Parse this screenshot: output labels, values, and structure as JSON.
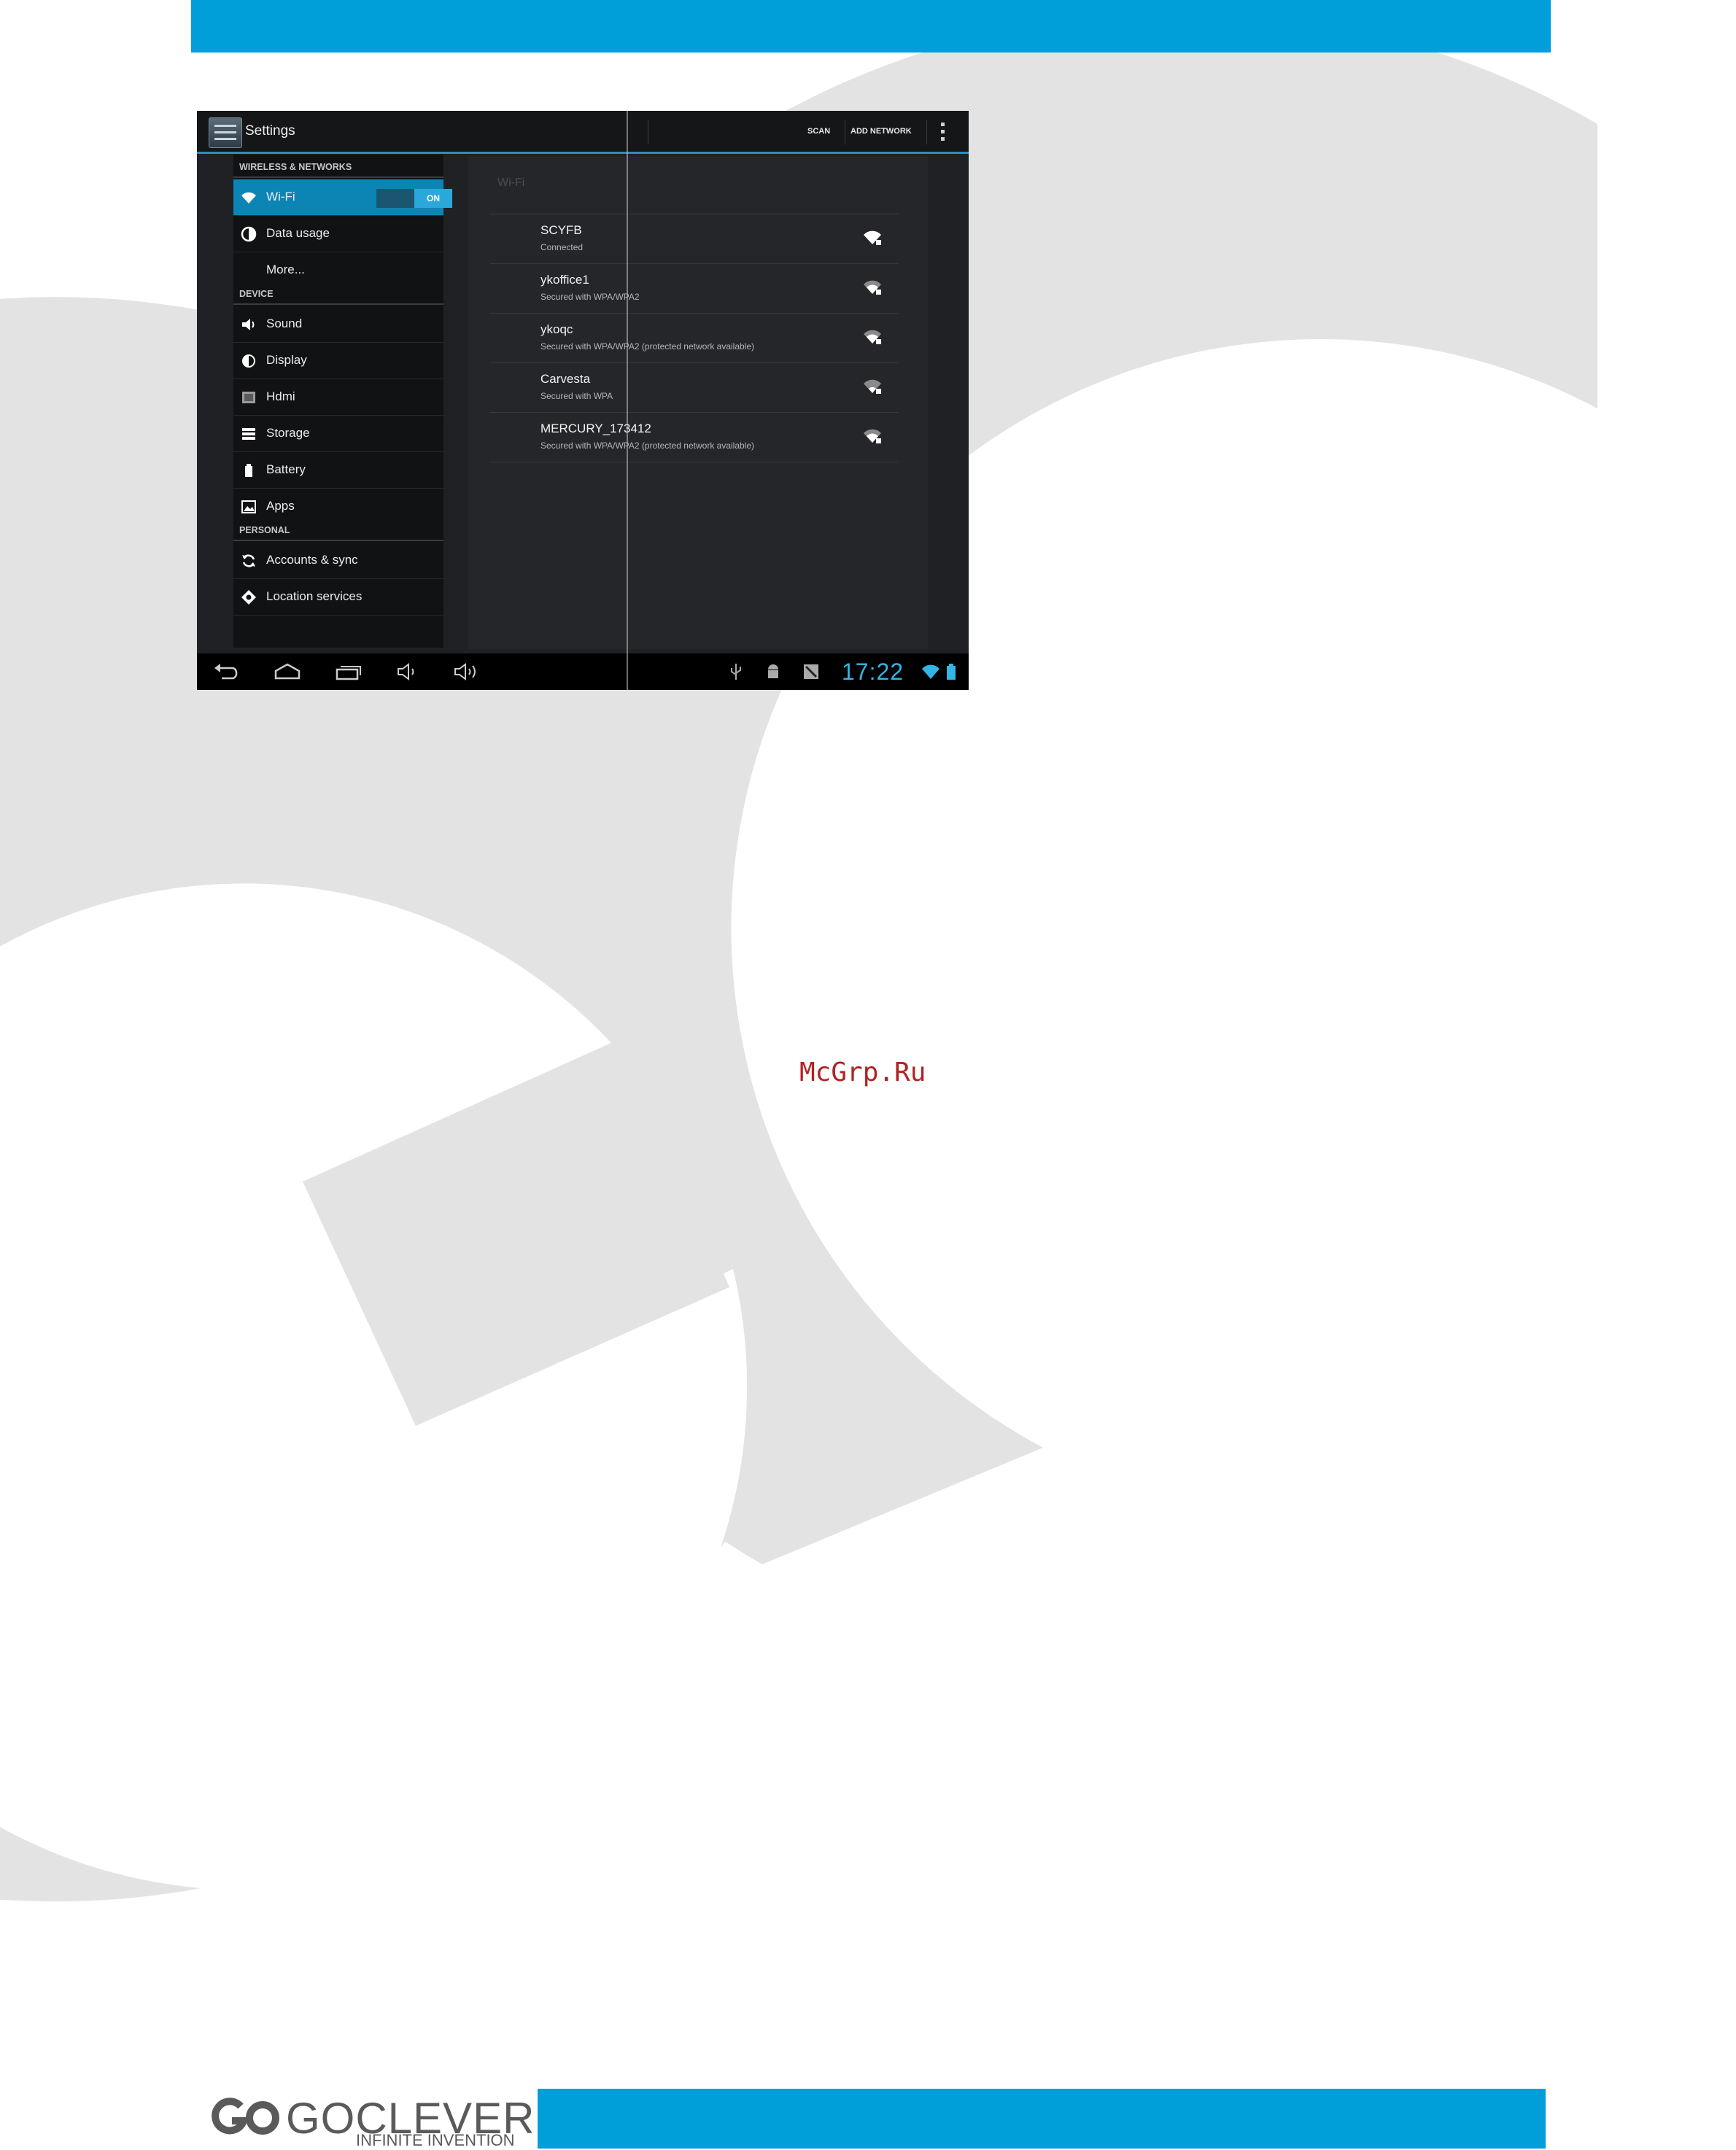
{
  "brand": {
    "accent": "#009fda",
    "android_accent": "#33b5e5",
    "watermark_color": "#e3e3e3"
  },
  "screenshot": {
    "actionbar": {
      "title": "Settings",
      "actions": [
        {
          "label": "SCAN"
        },
        {
          "label": "ADD NETWORK"
        }
      ],
      "overflow_icon": "overflow-menu-icon"
    },
    "sections": {
      "wireless": "WIRELESS & NETWORKS",
      "device": "DEVICE",
      "personal": "PERSONAL"
    },
    "nav_items": [
      {
        "label": "Wi-Fi",
        "icon": "wifi-icon",
        "selected": true
      },
      {
        "label": "Data usage",
        "icon": "data-usage-icon"
      },
      {
        "label": "More...",
        "icon": ""
      },
      {
        "label": "Sound",
        "icon": "speaker-icon"
      },
      {
        "label": "Display",
        "icon": "display-icon"
      },
      {
        "label": "Hdmi",
        "icon": "hdmi-icon"
      },
      {
        "label": "Storage",
        "icon": "storage-icon"
      },
      {
        "label": "Battery",
        "icon": "battery-icon"
      },
      {
        "label": "Apps",
        "icon": "apps-icon"
      },
      {
        "label": "Accounts & sync",
        "icon": "sync-icon"
      },
      {
        "label": "Location services",
        "icon": "location-icon"
      }
    ],
    "wifi_toggle": {
      "label": "ON",
      "state": true
    },
    "wifi_panel": {
      "title": "Wi-Fi",
      "networks": [
        {
          "name": "SCYFB",
          "status": "Connected"
        },
        {
          "name": "ykoffice1",
          "status": "Secured with WPA/WPA2"
        },
        {
          "name": "ykoqc",
          "status": "Secured with WPA/WPA2 (protected network available)"
        },
        {
          "name": "Carvesta",
          "status": "Secured with WPA"
        },
        {
          "name": "MERCURY_173412",
          "status": "Secured with WPA/WPA2 (protected network available)"
        }
      ]
    },
    "system_bar": {
      "clock": "17:22",
      "nav_icons": [
        "back-icon",
        "home-icon",
        "recent-apps-icon",
        "volume-down-icon",
        "volume-up-icon"
      ],
      "status_icons": [
        "usb-icon",
        "android-debug-icon",
        "screenshot-icon",
        "wifi-status-icon",
        "battery-status-icon"
      ]
    }
  },
  "site_mark": "McGrp.Ru",
  "footer": {
    "logo": "GOCLEVER",
    "logo_mark": "GO",
    "tagline": "INFINITE INVENTION"
  }
}
